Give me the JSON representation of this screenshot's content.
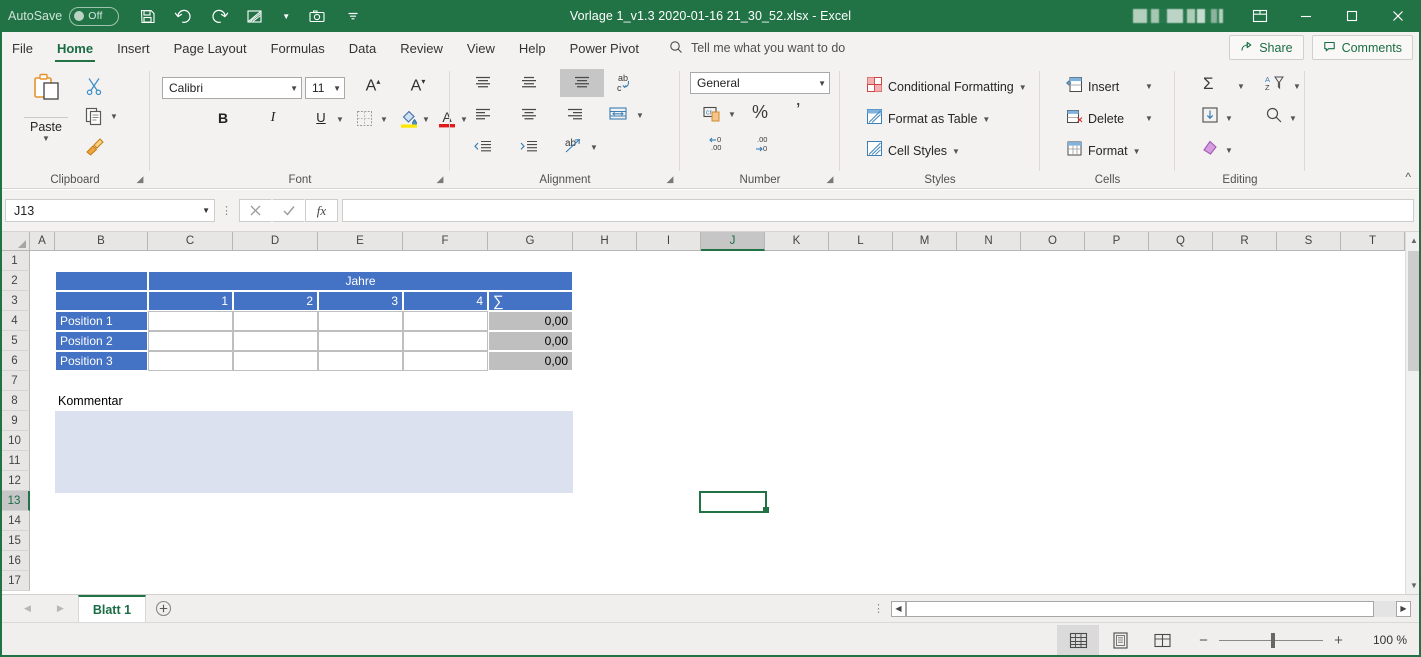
{
  "titlebar": {
    "autosave_label": "AutoSave",
    "autosave_state": "Off",
    "document_title": "Vorlage 1_v1.3 2020-01-16 21_30_52.xlsx  -  Excel",
    "quick_access": [
      {
        "name": "save-icon",
        "tooltip": "Save"
      },
      {
        "name": "undo-icon",
        "tooltip": "Undo"
      },
      {
        "name": "redo-icon",
        "tooltip": "Redo"
      },
      {
        "name": "picture-icon",
        "tooltip": "Insert Picture"
      },
      {
        "name": "camera-icon",
        "tooltip": "Camera"
      },
      {
        "name": "customize-qat-icon",
        "tooltip": "Customize Quick Access Toolbar"
      }
    ],
    "window_controls": [
      {
        "name": "ribbon-display-options-icon",
        "glyph": "ribbon"
      },
      {
        "name": "minimize-icon",
        "glyph": "—"
      },
      {
        "name": "maximize-icon",
        "glyph": "□"
      },
      {
        "name": "close-icon",
        "glyph": "✕"
      }
    ],
    "accent_color": "#217346"
  },
  "ribbon_tabs": {
    "tabs": [
      {
        "label": "File",
        "active": false
      },
      {
        "label": "Home",
        "active": true
      },
      {
        "label": "Insert",
        "active": false
      },
      {
        "label": "Page Layout",
        "active": false
      },
      {
        "label": "Formulas",
        "active": false
      },
      {
        "label": "Data",
        "active": false
      },
      {
        "label": "Review",
        "active": false
      },
      {
        "label": "View",
        "active": false
      },
      {
        "label": "Help",
        "active": false
      },
      {
        "label": "Power Pivot",
        "active": false
      }
    ],
    "tellme_placeholder": "Tell me what you want to do",
    "share_label": "Share",
    "comments_label": "Comments"
  },
  "ribbon": {
    "groups": [
      {
        "name": "clipboard",
        "label": "Clipboard"
      },
      {
        "name": "font",
        "label": "Font"
      },
      {
        "name": "alignment",
        "label": "Alignment"
      },
      {
        "name": "number",
        "label": "Number"
      },
      {
        "name": "styles",
        "label": "Styles"
      },
      {
        "name": "cells",
        "label": "Cells"
      },
      {
        "name": "editing",
        "label": "Editing"
      }
    ],
    "clipboard": {
      "paste_label": "Paste",
      "cut_tooltip": "Cut",
      "copy_tooltip": "Copy",
      "format_painter_tooltip": "Format Painter"
    },
    "font": {
      "font_name": "Calibri",
      "font_size": "11",
      "bold": "B",
      "italic": "I",
      "underline": "U",
      "increase_font": "A",
      "decrease_font": "A"
    },
    "number": {
      "format": "General",
      "percent": "%",
      "comma": "’"
    },
    "styles": {
      "conditional_formatting": "Conditional Formatting",
      "format_as_table": "Format as Table",
      "cell_styles": "Cell Styles"
    },
    "cells": {
      "insert": "Insert",
      "delete": "Delete",
      "format": "Format"
    },
    "editing": {
      "autosum_tooltip": "AutoSum",
      "fill_tooltip": "Fill",
      "clear_tooltip": "Clear",
      "sort_filter_tooltip": "Sort & Filter",
      "find_select_tooltip": "Find & Select"
    },
    "collapse_tooltip": "Collapse the Ribbon"
  },
  "formula_bar": {
    "name_box_value": "J13",
    "cancel_icon": "✕",
    "enter_icon": "✓",
    "function_icon": "fx",
    "formula_value": ""
  },
  "grid": {
    "columns": [
      "A",
      "B",
      "C",
      "D",
      "E",
      "F",
      "G",
      "H",
      "I",
      "J",
      "K",
      "L",
      "M",
      "N",
      "O",
      "P",
      "Q",
      "R",
      "S",
      "T"
    ],
    "active_column": "J",
    "rows": [
      1,
      2,
      3,
      4,
      5,
      6,
      7,
      8,
      9,
      10,
      11,
      12,
      13,
      14,
      15,
      16,
      17
    ],
    "active_row": 13,
    "selected_cell": "J13",
    "table": {
      "title_header": "Jahre",
      "year_headers": [
        "1",
        "2",
        "3",
        "4"
      ],
      "sum_header": "∑",
      "row_labels": [
        "Position 1",
        "Position 2",
        "Position 3"
      ],
      "sum_values": [
        "0,00",
        "0,00",
        "0,00"
      ],
      "data_values": [
        [
          "",
          "",
          "",
          ""
        ],
        [
          "",
          "",
          "",
          ""
        ],
        [
          "",
          "",
          "",
          ""
        ]
      ],
      "header_color": "#4472c4",
      "sum_color": "#bfbfbf"
    },
    "comment": {
      "label": "Kommentar",
      "value": "",
      "box_color": "#dce1f0"
    }
  },
  "sheet_bar": {
    "prev_icon": "◀",
    "next_icon": "▶",
    "tabs": [
      {
        "label": "Blatt 1",
        "active": true
      }
    ],
    "add_sheet_icon": "+"
  },
  "status_bar": {
    "views": [
      {
        "name": "normal-view",
        "active": true
      },
      {
        "name": "page-layout-view",
        "active": false
      },
      {
        "name": "page-break-preview",
        "active": false
      }
    ],
    "zoom_out": "−",
    "zoom_in": "+",
    "zoom_level": "100 %"
  }
}
